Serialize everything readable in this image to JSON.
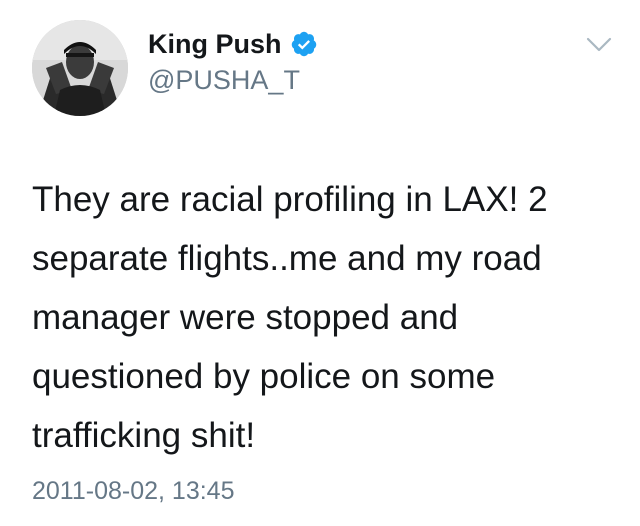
{
  "tweet": {
    "author": {
      "display_name": "King Push",
      "handle": "@PUSHA_T",
      "verified": true,
      "avatar_icon": "user-avatar"
    },
    "menu_icon": "chevron-down-icon",
    "text_lines": [
      "They are racial profiling in LAX! 2",
      "separate flights..me and my road",
      "manager were stopped and",
      "questioned by police on some",
      "trafficking shit!"
    ],
    "timestamp": "2011-08-02, 13:45"
  },
  "colors": {
    "text": "#14171a",
    "secondary_text": "#657786",
    "verified_badge": "#1da1f2",
    "background": "#ffffff"
  }
}
